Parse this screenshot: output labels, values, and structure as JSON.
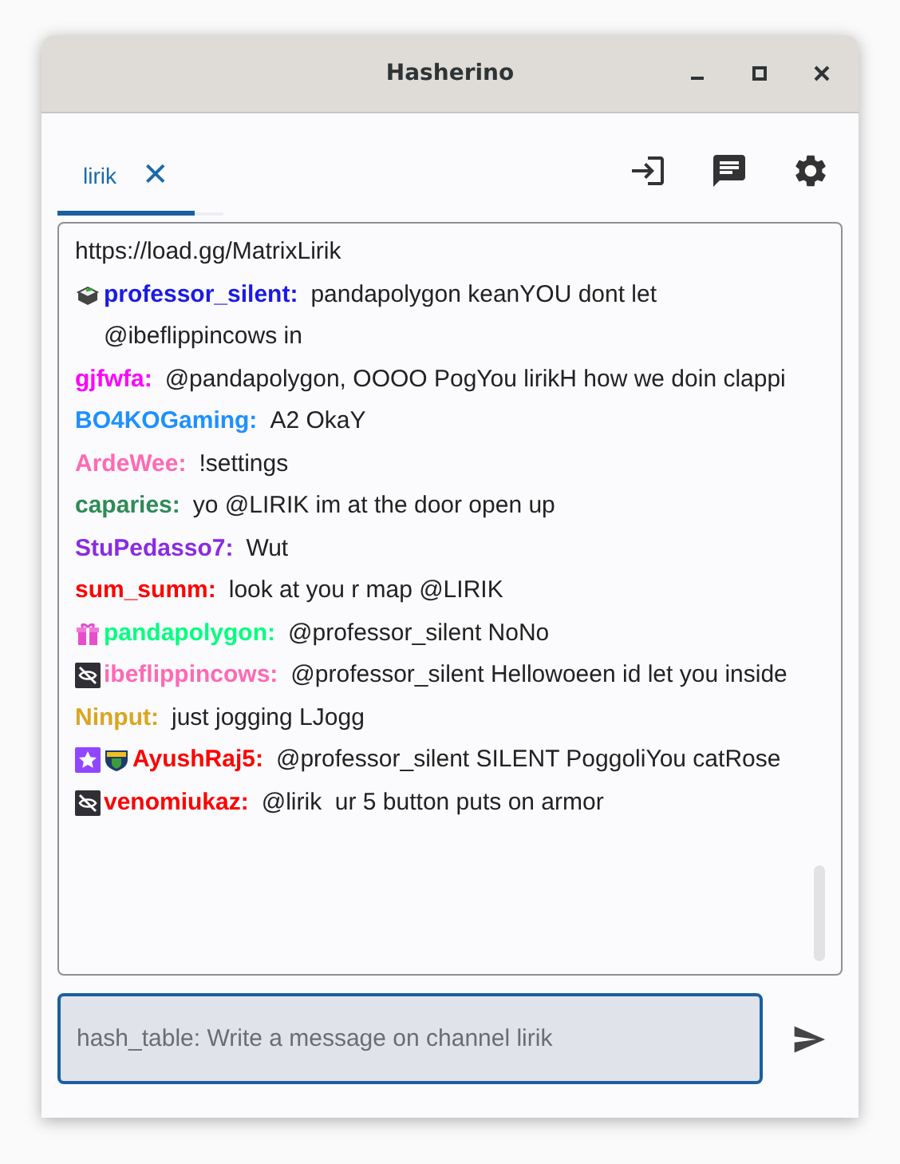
{
  "window": {
    "title": "Hasherino"
  },
  "tabs": [
    {
      "label": "lirik",
      "selected": true,
      "close": "✕"
    }
  ],
  "messages": [
    {
      "text": "https://load.gg/MatrixLirik"
    },
    {
      "user": "professor_silent:",
      "color": "#1a1ae6",
      "badges": [
        {
          "kind": "bits"
        }
      ],
      "text": "pandapolygon keanYOU dont let @ibeflippincows in"
    },
    {
      "user": "gjfwfa:",
      "color": "#ff00ff",
      "text": "@pandapolygon, OOOO PogYou lirikH how we doin clappi"
    },
    {
      "user": "BO4KOGaming:",
      "color": "#1e90ff",
      "text": "A2 OkaY"
    },
    {
      "user": "ArdeWee:",
      "color": "#ff69b4",
      "text": "!settings"
    },
    {
      "user": "caparies:",
      "color": "#2e8b57",
      "text": "yo @LIRIK im at the door open up"
    },
    {
      "user": "StuPedasso7:",
      "color": "#8a2be2",
      "text": "Wut"
    },
    {
      "user": "sum_summ:",
      "color": "#ff0000",
      "text": "look at you r map @LIRIK"
    },
    {
      "user": "pandapolygon:",
      "color": "#00ff7f",
      "badges": [
        {
          "kind": "gift"
        }
      ],
      "text": "@professor_silent NoNo"
    },
    {
      "user": "ibeflippincows:",
      "color": "#ff69b4",
      "badges": [
        {
          "kind": "crossed"
        }
      ],
      "text": "@professor_silent Hellowoeen id let you inside"
    },
    {
      "user": "Ninput:",
      "color": "#daa520",
      "text": "just jogging LJogg"
    },
    {
      "user": "AyushRaj5:",
      "color": "#ff0000",
      "badges": [
        {
          "kind": "star"
        },
        {
          "kind": "shield"
        }
      ],
      "text": "@professor_silent SILENT PoggoliYou catRose"
    },
    {
      "user": "venomiukaz:",
      "color": "#ff0000",
      "badges": [
        {
          "kind": "crossed"
        }
      ],
      "text": "@lirik  ur 5 button puts on armor"
    }
  ],
  "input": {
    "placeholder": "hash_table: Write a message on channel lirik"
  }
}
